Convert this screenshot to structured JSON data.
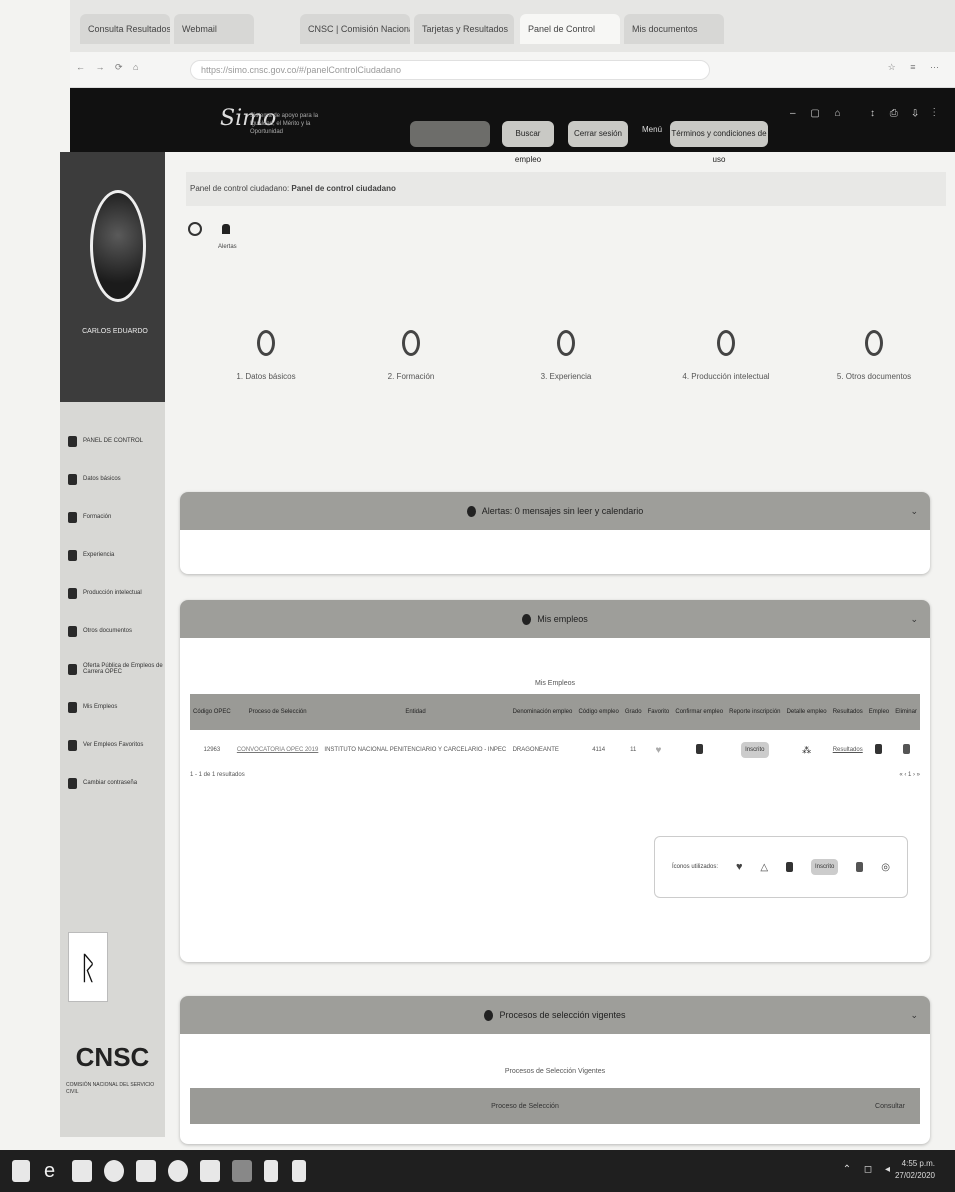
{
  "browser": {
    "tabs": [
      "Consulta Resultados",
      "Webmail",
      "CNSC | Comisión Nacional",
      "Tarjetas y Resultados",
      "Panel de Control",
      "Mis documentos"
    ],
    "url": "https://simo.cnsc.gov.co/#/panelControlCiudadano"
  },
  "header": {
    "logo": "Simo",
    "logo_subtitle": "Sistema de apoyo para la Igualdad, el Mérito y la Oportunidad",
    "buttons": [
      "Buscar empleo",
      "Cerrar sesión",
      "Términos y condiciones de uso"
    ],
    "menu_label": "Menú"
  },
  "sidebar": {
    "user_name": "CARLOS EDUARDO",
    "items": [
      "PANEL DE CONTROL",
      "Datos básicos",
      "Formación",
      "Experiencia",
      "Producción intelectual",
      "Otros documentos",
      "Oferta Pública de Empleos de Carrera OPEC",
      "Mis Empleos",
      "Ver Empleos Favoritos",
      "Cambiar contraseña"
    ],
    "org_name": "CNSC",
    "org_subtitle": "COMISIÓN NACIONAL DEL SERVICIO CIVIL"
  },
  "breadcrumb": {
    "prefix": "Panel de control ciudadano:",
    "current": "Panel de control ciudadano"
  },
  "alerts_label": "Alertas",
  "steps": [
    "1. Datos básicos",
    "2. Formación",
    "3. Experiencia",
    "4. Producción intelectual",
    "5. Otros documentos"
  ],
  "alerts_panel": {
    "title": "Alertas: 0 mensajes sin leer y calendario"
  },
  "jobs_panel": {
    "title": "Mis empleos",
    "table_title": "Mis Empleos",
    "columns": [
      "Código OPEC",
      "Proceso de Selección",
      "Entidad",
      "Denominación empleo",
      "Código empleo",
      "Grado",
      "Favorito",
      "Confirmar empleo",
      "Reporte inscripción",
      "Detalle empleo",
      "Resultados",
      "Empleo",
      "Eliminar"
    ],
    "row": {
      "codigo": "12963",
      "proceso": "CONVOCATORIA OPEC 2019",
      "entidad": "INSTITUTO NACIONAL PENITENCIARIO Y CARCELARIO - INPEC",
      "denominacion": "DRAGONEANTE",
      "codigo_empleo": "4114",
      "grado": "11",
      "reporte": "Inscrito",
      "resultados": "Resultados"
    },
    "results_count": "1 - 1 de 1 resultados",
    "pagination": "« ‹ 1 › »",
    "legend_label": "Íconos utilizados:",
    "legend_badge": "Inscrito"
  },
  "processes_panel": {
    "title": "Procesos de selección vigentes",
    "table_title": "Procesos de Selección Vigentes",
    "col_process": "Proceso de Selección",
    "col_consult": "Consultar"
  },
  "taskbar": {
    "time": "4:55 p.m.",
    "date": "27/02/2020"
  }
}
